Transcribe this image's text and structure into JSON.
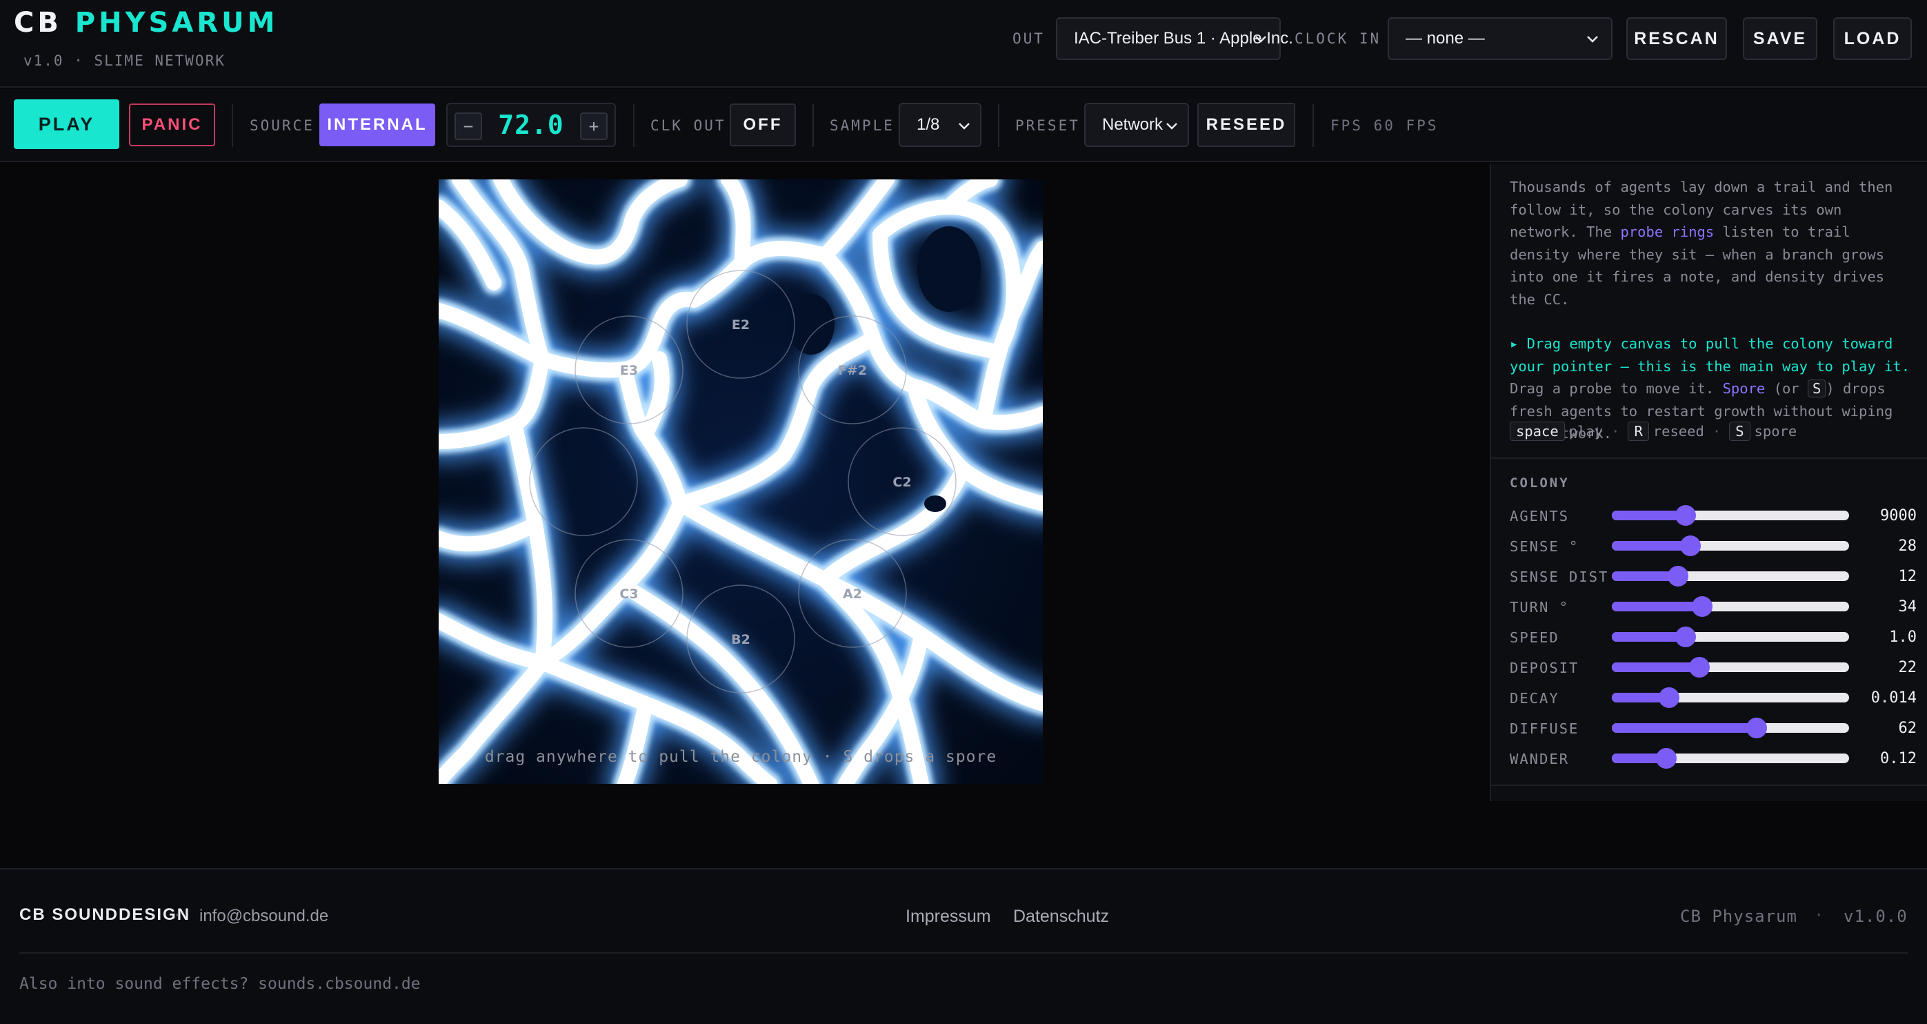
{
  "header": {
    "brand_prefix": "CB",
    "brand_name": "PHYSARUM",
    "version_line": "v1.0 · SLIME NETWORK",
    "out_label": "OUT",
    "out_device": "IAC-Treiber Bus 1 · Apple Inc.",
    "clock_in_label": "CLOCK IN",
    "clock_in_value": "— none —",
    "rescan": "RESCAN",
    "save": "SAVE",
    "load": "LOAD"
  },
  "toolbar": {
    "play": "PLAY",
    "panic": "PANIC",
    "source_label": "SOURCE",
    "source_value": "INTERNAL",
    "bpm_minus": "−",
    "bpm": "72.0",
    "bpm_plus": "+",
    "clk_out_label": "CLK OUT",
    "clk_out_value": "OFF",
    "sample_label": "SAMPLE",
    "sample_value": "1/8",
    "preset_label": "PRESET",
    "preset_value": "Network",
    "reseed": "RESEED",
    "fps": "FPS 60 FPS"
  },
  "canvas": {
    "probes": [
      "E2",
      "E3",
      "F#2",
      "C2",
      "",
      "C3",
      "A2",
      "B2"
    ],
    "hint": "drag anywhere to pull the colony · S drops a spore"
  },
  "sidebar": {
    "desc_1a": "Thousands of agents lay down a trail and then follow it, so the colony carves its own network. The ",
    "desc_1b": "probe rings",
    "desc_1c": " listen to trail density where they sit — when a branch grows into one it fires a note, and density drives the CC.",
    "desc_2a": "▸ Drag empty canvas to pull the colony toward your pointer — this is the main way to play it.",
    "desc_2b": " Drag a probe to move it. ",
    "desc_2c": "Spore",
    "desc_2d": " (or ",
    "desc_2e": "S",
    "desc_2f": ") drops fresh agents to restart growth without wiping the network.",
    "shortcuts": [
      {
        "key": "space",
        "label": "play"
      },
      {
        "key": "R",
        "label": "reseed"
      },
      {
        "key": "S",
        "label": "spore"
      }
    ],
    "section_title": "COLONY",
    "sliders": [
      {
        "label": "AGENTS",
        "value": "9000",
        "fraction": 0.31
      },
      {
        "label": "SENSE °",
        "value": "28",
        "fraction": 0.33
      },
      {
        "label": "SENSE DIST",
        "value": "12",
        "fraction": 0.28
      },
      {
        "label": "TURN °",
        "value": "34",
        "fraction": 0.38
      },
      {
        "label": "SPEED",
        "value": "1.0",
        "fraction": 0.31
      },
      {
        "label": "DEPOSIT",
        "value": "22",
        "fraction": 0.37
      },
      {
        "label": "DECAY",
        "value": "0.014",
        "fraction": 0.24
      },
      {
        "label": "DIFFUSE",
        "value": "62",
        "fraction": 0.61
      },
      {
        "label": "WANDER",
        "value": "0.12",
        "fraction": 0.23
      }
    ]
  },
  "footer": {
    "brand": "CB SOUNDDESIGN",
    "dot": "·",
    "email": "info@cbsound.de",
    "impressum": "Impressum",
    "datenschutz": "Datenschutz",
    "app_name": "CB Physarum",
    "app_version": "v1.0.0",
    "promo": "Also into sound effects? sounds.cbsound.de"
  },
  "colors": {
    "accent_teal": "#19e6cf",
    "accent_purple": "#7b5cf5",
    "panic_red": "#ff4f78"
  }
}
